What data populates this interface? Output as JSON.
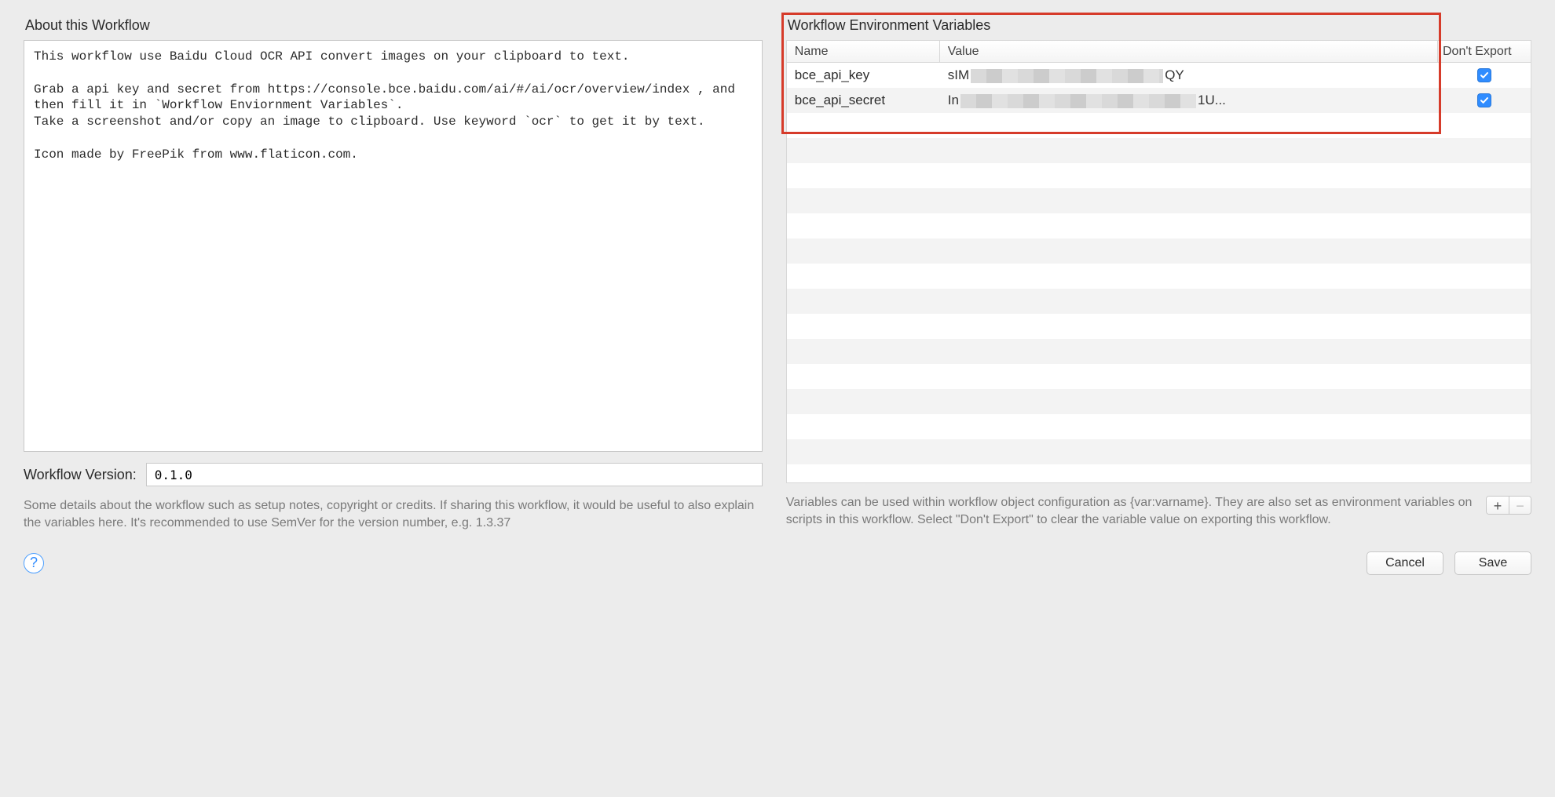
{
  "left": {
    "title": "About this Workflow",
    "about_text": "This workflow use Baidu Cloud OCR API convert images on your clipboard to text.\n\nGrab a api key and secret from https://console.bce.baidu.com/ai/#/ai/ocr/overview/index , and then fill it in `Workflow Enviornment Variables`.\nTake a screenshot and/or copy an image to clipboard. Use keyword `ocr` to get it by text.\n\nIcon made by FreePik from www.flaticon.com.",
    "version_label": "Workflow Version:",
    "version_value": "0.1.0",
    "help_text": "Some details about the workflow such as setup notes, copyright or credits. If sharing this workflow, it would be useful to also explain the variables here. It's recommended to use SemVer for the version number, e.g. 1.3.37"
  },
  "right": {
    "title": "Workflow Environment Variables",
    "columns": {
      "name": "Name",
      "value": "Value",
      "dont_export": "Don't Export"
    },
    "rows": [
      {
        "name": "bce_api_key",
        "value_prefix": "sIM",
        "value_suffix": "QY",
        "dont_export": true
      },
      {
        "name": "bce_api_secret",
        "value_prefix": "In",
        "value_suffix": "1U...",
        "dont_export": true
      }
    ],
    "help_text": "Variables can be used within workflow object configuration as {var:varname}. They are also set as environment variables on scripts in this workflow. Select \"Don't Export\" to clear the variable value on exporting this workflow.",
    "add_label": "+",
    "remove_label": "−"
  },
  "buttons": {
    "help": "?",
    "cancel": "Cancel",
    "save": "Save"
  }
}
